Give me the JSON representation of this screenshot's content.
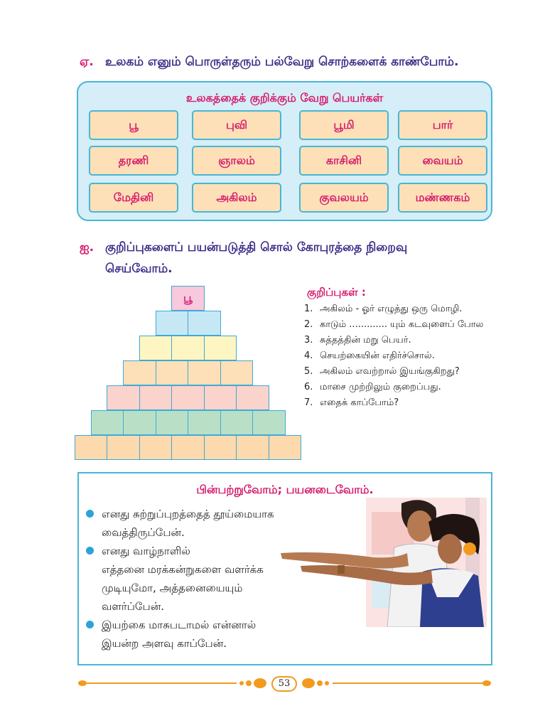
{
  "section_a": {
    "label": "ஏ.",
    "text": "உலகம் எனும் பொருள்தரும் பல்வேறு சொற்களைக் காண்போம்."
  },
  "synonyms_box": {
    "title": "உலகத்தைக் குறிக்கும் வேறு பெயர்கள்",
    "words": [
      "பூ",
      "புவி",
      "பூமி",
      "பார்",
      "தரணி",
      "ஞாலம்",
      "காசினி",
      "வையம்",
      "மேதினி",
      "அகிலம்",
      "குவலயம்",
      "மண்ணகம்"
    ]
  },
  "section_b": {
    "label": "ஐ.",
    "line1": "குறிப்புகளைப் பயன்படுத்தி சொல் கோபுரத்தை நிறைவு",
    "line2": "செய்வோம்."
  },
  "pyramid": {
    "top_word": "பூ",
    "row_cells": [
      1,
      2,
      3,
      4,
      5,
      6,
      7
    ],
    "row_colors": [
      "#f8c8dc",
      "#c6e8f5",
      "#fdf6c3",
      "#fde0b7",
      "#f9d3cc",
      "#b9e0c7",
      "#fdd9ae"
    ]
  },
  "clues": {
    "title": "குறிப்புகள் :",
    "items": [
      {
        "num": "1.",
        "text": "அகிலம் - ஓர் எழுத்து ஒரு மொழி."
      },
      {
        "num": "2.",
        "text": "காடும் ............. யும் கடவுளைப் போல"
      },
      {
        "num": "3.",
        "text": "சுத்தத்தின் மறு பெயர்."
      },
      {
        "num": "4.",
        "text": "செயற்கையின் எதிர்ச்சொல்."
      },
      {
        "num": "5.",
        "text": "அகிலம் எவற்றால் இயங்குகிறது?"
      },
      {
        "num": "6.",
        "text": "மாசை முற்றிலும் குறைப்பது."
      },
      {
        "num": "7.",
        "text": "எதைக் காப்போம்?"
      }
    ]
  },
  "follow_box": {
    "title": "பின்பற்றுவோம்; பயனடைவோம்.",
    "items": [
      {
        "line1": "எனது சுற்றுப்புறத்தைத் தூய்மையாக",
        "line2": "வைத்திருப்பேன்."
      },
      {
        "line1": "எனது வாழ்நாளில்",
        "line2": "எத்தனை மரக்கன்றுகளை வளர்க்க",
        "line3": "முடியுமோ, அத்தனையையும்",
        "line4": "வளர்ப்பேன்."
      },
      {
        "line1": "இயற்கை மாசுபடாமல் என்னால்",
        "line2": "இயன்ற அளவு காப்பேன்."
      }
    ]
  },
  "footer": {
    "page_number": "53"
  },
  "colors": {
    "accent_pink": "#d6196b",
    "heading_blue": "#3a2a86",
    "border_cyan": "#49b6d6",
    "ornament_orange": "#f39a1e"
  }
}
